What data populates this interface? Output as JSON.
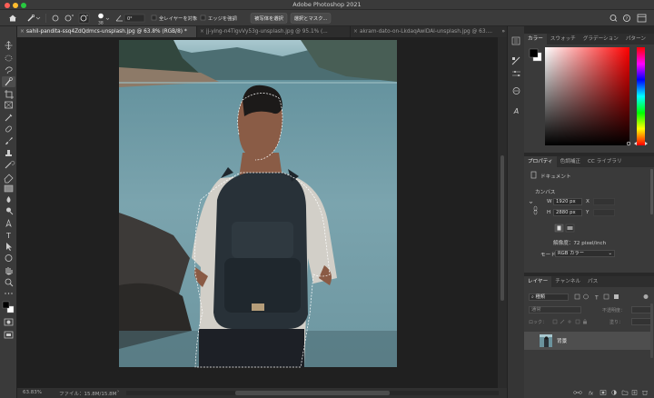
{
  "app": {
    "title": "Adobe Photoshop 2021"
  },
  "options_bar": {
    "brush_size": "38",
    "angle": "0°",
    "sample_all_layers": "全レイヤーを対象",
    "enhance_edge": "エッジを強調",
    "select_subject": "被写体を選択",
    "select_and_mask": "選択とマスク..."
  },
  "tabs": [
    {
      "label": "sahil-pandita-ssq4ZdQdmcs-unsplash.jpg @ 63.8% (RGB/8) *",
      "active": true
    },
    {
      "label": "jj-ying-n4TigvVy53g-unsplash.jpg @ 95.1% (...",
      "active": false
    },
    {
      "label": "akram-dato-on-LkdaqAwlDAI-unsplash.jpg @ 63....",
      "active": false
    }
  ],
  "status": {
    "zoom": "63.83%",
    "file_info": "ファイル：15.8M/15.8M"
  },
  "color_panel": {
    "tabs": [
      "カラー",
      "スウォッチ",
      "グラデーション",
      "パターン"
    ],
    "hue_color": "#ff0000"
  },
  "properties_panel": {
    "tabs": [
      "プロパティ",
      "色調補正",
      "CC ライブラリ"
    ],
    "doc_type": "ドキュメント",
    "section": "カンバス",
    "w_label": "W",
    "w_value": "1920 px",
    "h_label": "H",
    "h_value": "2880 px",
    "x_label": "X",
    "y_label": "Y",
    "resolution": "解像度：72 pixel/inch",
    "mode_label": "モード",
    "mode_value": "RGB カラー"
  },
  "layers_panel": {
    "tabs": [
      "レイヤー",
      "チャンネル",
      "パス"
    ],
    "filter": "種類",
    "blend": "通常",
    "opacity_label": "不透明度：",
    "lock_label": "ロック：",
    "fill_label": "塗り：",
    "layer_name": "背景"
  }
}
